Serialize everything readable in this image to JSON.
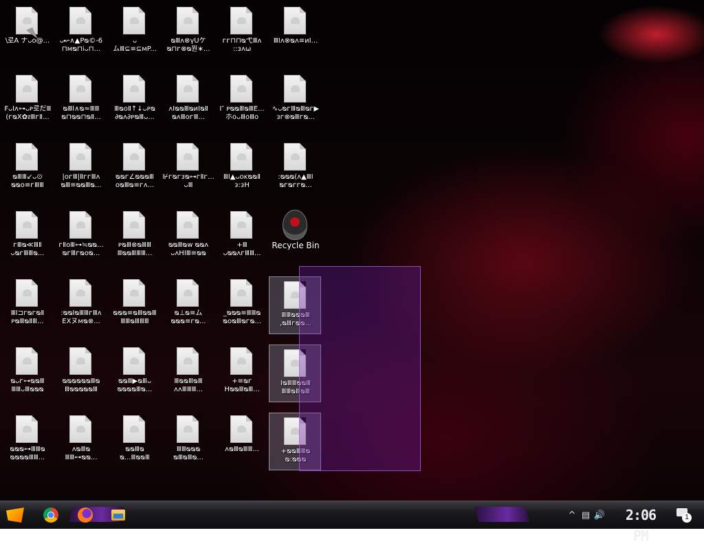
{
  "desktop": {
    "icons": [
      {
        "line1": "\\로A ナᴗᴏ@...",
        "line2": ""
      },
      {
        "line1": "ᴗ↜∧▲Pᴓ©-6",
        "line2": "⊓ᴍᴓ⊓ⅰᴗ⊓..."
      },
      {
        "line1": "ᴗ",
        "line2": "ムⅢ⊆≡⊆ᴍP..."
      },
      {
        "line1": "ᴓⅢᴧ⊗γUケ",
        "line2": "ᴓ⊓ᴦ⊗ᴓ뭔∗..."
      },
      {
        "line1": "ᴦᴦ⊓⊓ᴓ弋Ⅲᴧ",
        "line2": "::ᴈᴧω"
      },
      {
        "line1": "ⅢⅠᴧ⊗ᴓᴧ≡ᴎⅠ...",
        "line2": ""
      },
      {
        "line1": "₣ᴗⅠᴧ⊶ᴗᴘ로だⅢ",
        "line2": "(ᴦᴓX✿ᴤⅢᴦⅡ..."
      },
      {
        "line1": "ᴓⅢⅠ∧ᴓ≈ⅢⅢ",
        "line2": "ᴓ⊓ᴓᴓ⊓ᴓⅡ..."
      },
      {
        "line1": "ⅢᴓᴏⅡ↑↓ᴗᴘᴓ",
        "line2": "∂ᴓᴧ∂ᴘᴓⅢᴗ..."
      },
      {
        "line1": "ᴧⅠᴓᴓⅢᴓᴎⅠᴓⅡ",
        "line2": "ᴓᴧⅢᴏᴦⅢ..."
      },
      {
        "line1": "Ⅰ″ ᴘᴓᴓⅢᴓⅢE...",
        "line2": "ホᴏᴗⅢᴏⅢᴏ"
      },
      {
        "line1": "∿ᴗᴓᴦⅢᴓⅢᴓᴦ▶",
        "line2": "ᴈᴦ⊗ᴓⅢᴦᴓ..."
      },
      {
        "line1": "ᴓⅢⅢ↙ᴗ⊙",
        "line2": "ᴓᴓᴏ≡ᴦⅢⅢ"
      },
      {
        "line1": "|ᴏᴦⅢ|ⅡᴦᴦⅢᴧ",
        "line2": "ᴓⅢ≡ᴓᴓⅢᴓ..."
      },
      {
        "line1": "ᴓᴓᴦ∠ᴓᴓᴓⅢ",
        "line2": "ᴏᴓⅢᴓ≡ᴦᴧ..."
      },
      {
        "line1": "⊮ᴦᴓᴦᴈᴓ⊶ᴦⅡᴦ...",
        "line2": "ᴗⅢ"
      },
      {
        "line1": "ⅢⅠ▲ᴗᴏᴋᴓᴓⅡ",
        "line2": "ᴈ:ᴈH"
      },
      {
        "line1": ":ᴓᴓᴓ(ᴧ▲ⅢⅠ",
        "line2": "ᴓᴦᴓᴦᴦᴓ..."
      },
      {
        "line1": "ᴦⅢᴓ≪ⅢⅡ",
        "line2": "ᴗᴓᴦⅢⅢᴓ..."
      },
      {
        "line1": "ᴦⅡᴏⅢ⊶≒ᴓᴓ...",
        "line2": "ᴓᴦⅢᴦᴓᴏᴓ..."
      },
      {
        "line1": "ᴘᴓⅢ⊗ᴓⅢⅢ",
        "line2": "ⅢᴓᴓⅢⅢⅢ..."
      },
      {
        "line1": "ᴓᴓⅢᴓᴡ ᴓᴓᴧ",
        "line2": "ᴗᴧHⅠⅢ≡ᴓᴓ"
      },
      {
        "line1": "+Ⅲ",
        "line2": "ᴗᴓᴓᴧᴦⅢⅢ..."
      },
      {
        "line1": "ⅢⅠ⊐ᴦᴓᴦᴓⅡ",
        "line2": "ᴘᴓⅢᴓⅡⅢ..."
      },
      {
        "line1": ":ᴓᴓⅠᴓⅢⅢᴦⅢᴧ",
        "line2": "EXヌᴍᴓ⊗..."
      },
      {
        "line1": "ᴓᴓᴓ≡ᴓⅢᴓᴓⅢ",
        "line2": "ⅢⅢᴓⅢⅢⅢ"
      },
      {
        "line1": "ᴓ⊥ᴓ≡ム",
        "line2": "ᴓᴓᴓ≡ᴦᴓ..."
      },
      {
        "line1": "_ᴓᴓᴓ≡ⅢⅢᴓ",
        "line2": "ᴓᴏᴓⅢᴓᴦᴓ..."
      },
      {
        "line1": "ⅢⅢᴓᴓᴓⅢ",
        "line2": ",ᴓⅢᴦᴓᴓ..."
      },
      {
        "line1": "ᴓᴗᴦ⊶ᴓᴓⅢ",
        "line2": "ⅢⅢᴗⅢᴓᴓᴓ"
      },
      {
        "line1": "ᴓᴓᴓᴓᴓᴓⅢᴓ",
        "line2": "ⅢᴓᴓᴓᴓᴓⅢ"
      },
      {
        "line1": "ᴓᴓⅢ▶ᴓⅢᴗ",
        "line2": "ᴓᴓᴓᴓⅢᴓ..."
      },
      {
        "line1": "ⅢᴓᴓⅢᴓⅢ",
        "line2": "ᴧᴧⅢⅢⅢ..."
      },
      {
        "line1": "+≡ᴓᴦ",
        "line2": "HᴓᴓⅢᴓⅢ..."
      },
      {
        "line1": "ⅠᴓⅢⅢᴓᴓⅢ",
        "line2": "ⅢⅢᴓⅢᴓⅢ"
      },
      {
        "line1": "ᴓᴓᴓ⊶ⅢⅢᴓ",
        "line2": "ᴓᴓᴓᴓⅢⅢ..."
      },
      {
        "line1": "ᴧᴓⅢᴓ",
        "line2": "ⅢⅢ⊶ᴓᴓ..."
      },
      {
        "line1": "ᴓᴓⅢᴓ",
        "line2": "ᴓ...ⅢᴓᴓⅢ"
      },
      {
        "line1": "ⅢⅢᴓᴓᴓ",
        "line2": "ᴓⅢᴓⅢᴓ..."
      },
      {
        "line1": "ᴧᴓⅢᴓⅢⅢ...",
        "line2": ""
      },
      {
        "line1": "+ᴓᴓⅢⅢᴓ",
        "line2": "ᴓ:ᴓᴓᴓ"
      }
    ],
    "recycle_bin_label": "Recycle Bin"
  },
  "taskbar": {
    "clock": "2:06 PM",
    "notification_count": "1"
  }
}
